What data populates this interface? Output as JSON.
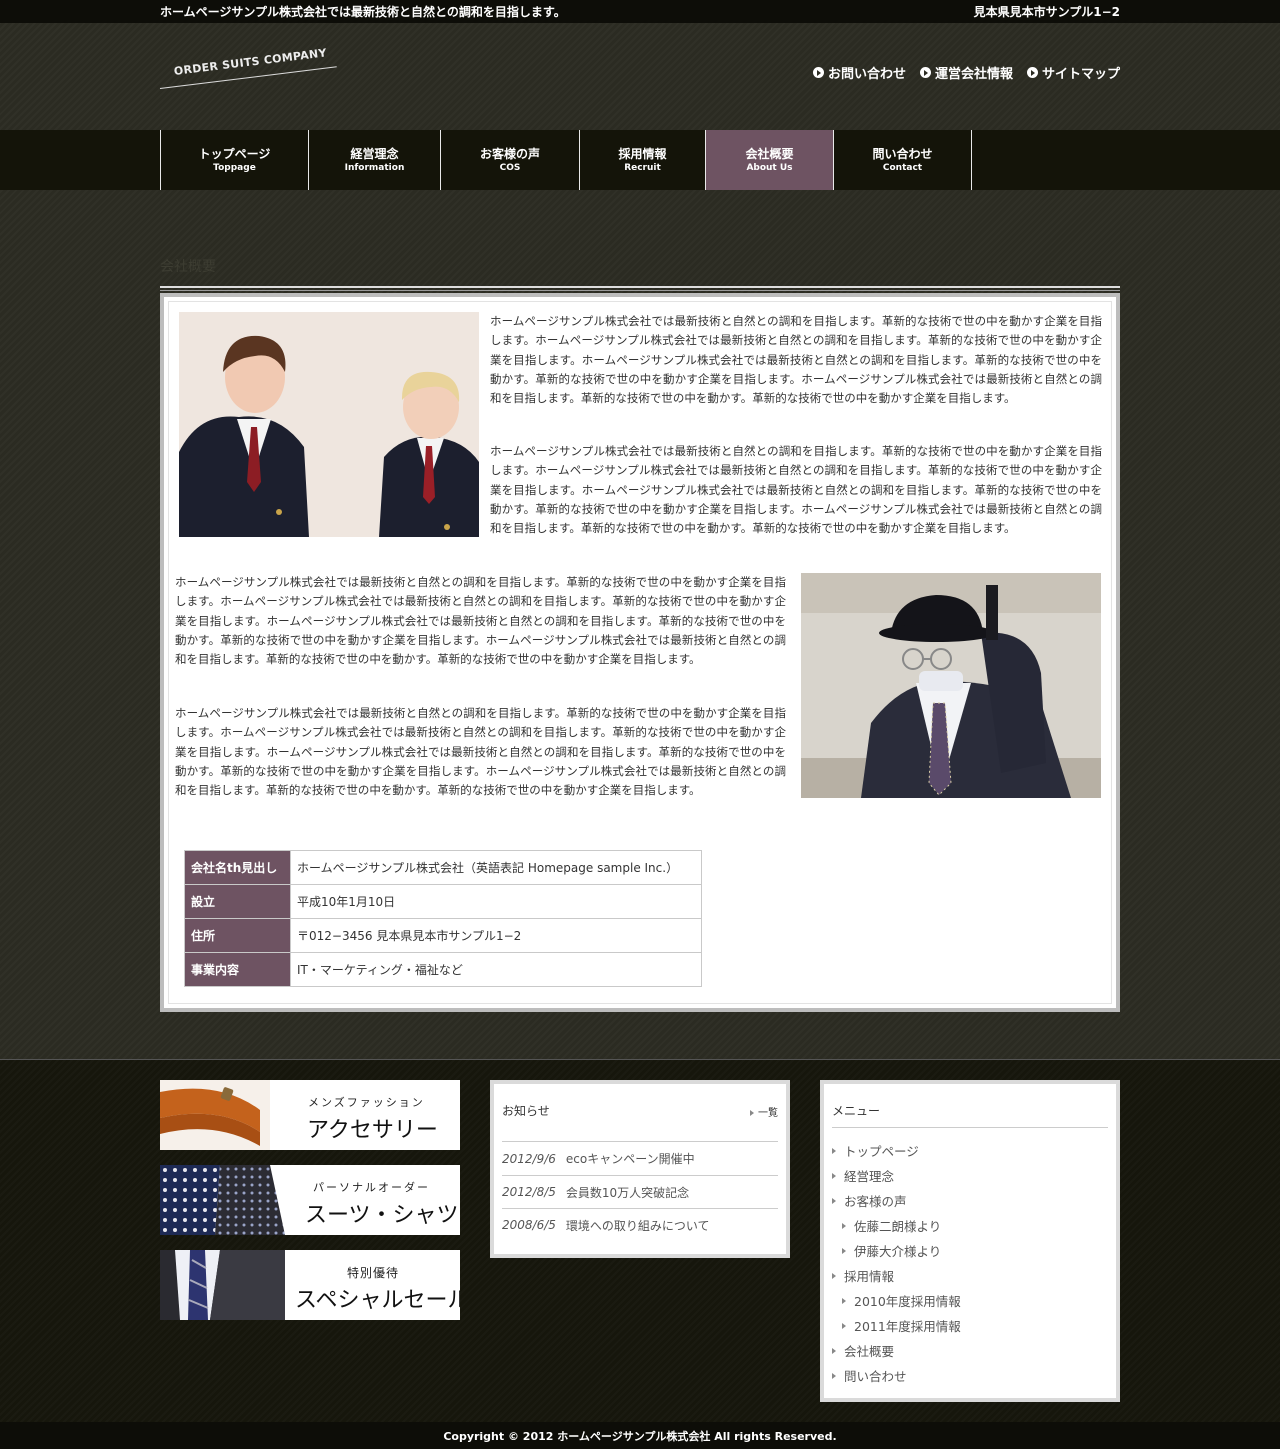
{
  "topbar": {
    "tagline": "ホームページサンプル株式会社では最新技術と自然との調和を目指します。",
    "address": "見本県見本市サンプル1−2"
  },
  "header": {
    "logo_text": "ORDER SUITS COMPANY",
    "links": [
      {
        "label": "お問い合わせ"
      },
      {
        "label": "運営会社情報"
      },
      {
        "label": "サイトマップ"
      }
    ]
  },
  "nav": {
    "items": [
      {
        "jp": "トップページ",
        "en": "Toppage"
      },
      {
        "jp": "経営理念",
        "en": "Information"
      },
      {
        "jp": "お客様の声",
        "en": "COS"
      },
      {
        "jp": "採用情報",
        "en": "Recruit"
      },
      {
        "jp": "会社概要",
        "en": "About Us"
      },
      {
        "jp": "問い合わせ",
        "en": "Contact"
      }
    ]
  },
  "page": {
    "heading": "会社概要",
    "paragraph": "ホームページサンプル株式会社では最新技術と自然との調和を目指します。革新的な技術で世の中を動かす企業を目指します。ホームページサンプル株式会社では最新技術と自然との調和を目指します。革新的な技術で世の中を動かす企業を目指します。ホームページサンプル株式会社では最新技術と自然との調和を目指します。革新的な技術で世の中を動かす。革新的な技術で世の中を動かす企業を目指します。ホームページサンプル株式会社では最新技術と自然との調和を目指します。革新的な技術で世の中を動かす。革新的な技術で世の中を動かす企業を目指します。"
  },
  "company_table": {
    "rows": [
      {
        "label": "会社名th見出し",
        "value": "ホームページサンプル株式会社（英語表記 Homepage sample Inc.）"
      },
      {
        "label": "設立",
        "value": "平成10年1月10日"
      },
      {
        "label": "住所",
        "value": "〒012−3456 見本県見本市サンプル1−2"
      },
      {
        "label": "事業内容",
        "value": "IT・マーケティング・福祉など"
      }
    ]
  },
  "banners": [
    {
      "sub": "メンズファッション",
      "main": "アクセサリー"
    },
    {
      "sub": "パーソナルオーダー",
      "main": "スーツ・シャツ"
    },
    {
      "sub": "特別優待",
      "main": "スペシャルセール"
    }
  ],
  "news": {
    "title": "お知らせ",
    "list_link": "一覧",
    "items": [
      {
        "date": "2012/9/6",
        "text": "ecoキャンペーン開催中"
      },
      {
        "date": "2012/8/5",
        "text": "会員数10万人突破記念"
      },
      {
        "date": "2008/6/5",
        "text": "環境への取り組みについて"
      }
    ]
  },
  "menu": {
    "title": "メニュー",
    "items": [
      {
        "label": "トップページ"
      },
      {
        "label": "経営理念"
      },
      {
        "label": "お客様の声"
      },
      {
        "label": "佐藤二朗様より"
      },
      {
        "label": "伊藤大介様より"
      },
      {
        "label": "採用情報"
      },
      {
        "label": "2010年度採用情報"
      },
      {
        "label": "2011年度採用情報"
      },
      {
        "label": "会社概要"
      },
      {
        "label": "問い合わせ"
      }
    ]
  },
  "footer": {
    "copyright": "Copyright © 2012 ホームページサンプル株式会社 All rights Reserved."
  },
  "colors": {
    "accent": "#6e5362",
    "background": "#2b2b22",
    "bar": "#0d0d08"
  }
}
